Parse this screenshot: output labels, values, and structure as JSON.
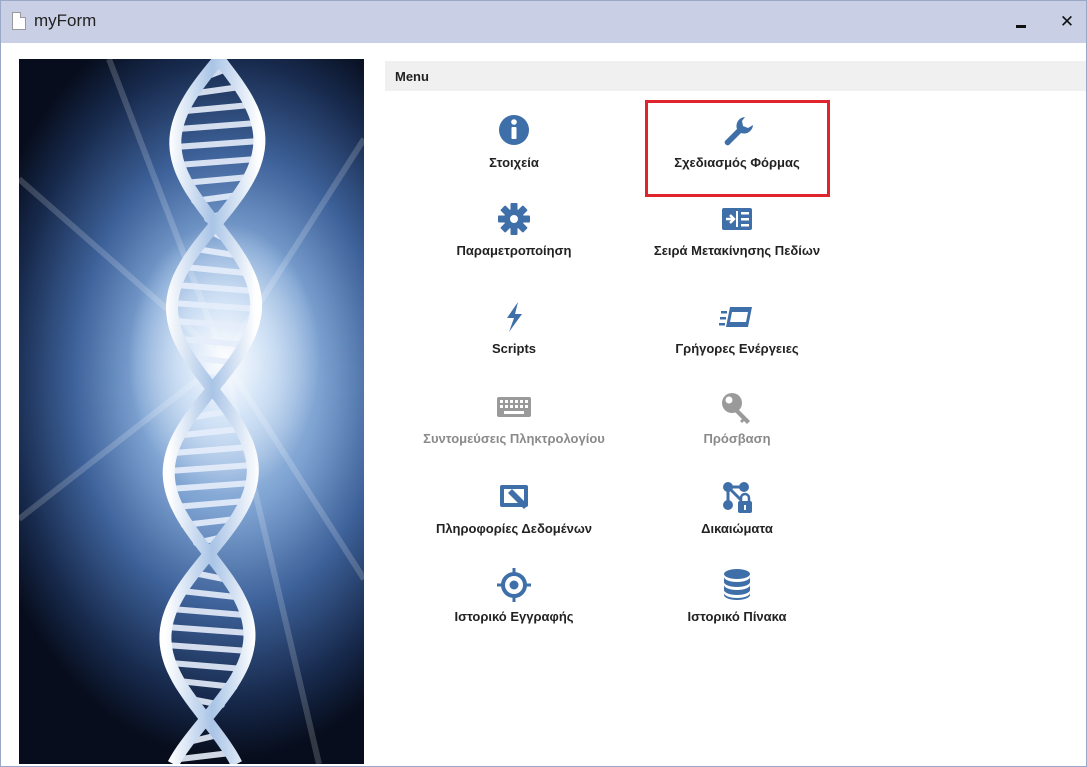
{
  "window": {
    "title": "myForm",
    "minimize_label": "‒",
    "close_label": "✕"
  },
  "menu": {
    "header": "Menu",
    "items": [
      {
        "label": "Στοιχεία",
        "icon": "info-icon",
        "enabled": true
      },
      {
        "label": "Σχεδιασμός Φόρμας",
        "icon": "wrench-icon",
        "enabled": true,
        "highlighted": true
      },
      {
        "label": "Παραμετροποίηση",
        "icon": "gear-icon",
        "enabled": true
      },
      {
        "label": "Σειρά Μετακίνησης Πεδίων",
        "icon": "tab-order-icon",
        "enabled": true
      },
      {
        "label": "Scripts",
        "icon": "lightning-icon",
        "enabled": true
      },
      {
        "label": "Γρήγορες Ενέργειες",
        "icon": "quick-actions-icon",
        "enabled": true
      },
      {
        "label": "Συντομεύσεις Πληκτρολογίου",
        "icon": "keyboard-icon",
        "enabled": false
      },
      {
        "label": "Πρόσβαση",
        "icon": "key-icon",
        "enabled": false
      },
      {
        "label": "Πληροφορίες Δεδομένων",
        "icon": "data-info-icon",
        "enabled": true
      },
      {
        "label": "Δικαιώματα",
        "icon": "permissions-icon",
        "enabled": true
      },
      {
        "label": "Ιστορικό Εγγραφής",
        "icon": "record-history-icon",
        "enabled": true
      },
      {
        "label": "Ιστορικό Πίνακα",
        "icon": "database-icon",
        "enabled": true
      }
    ]
  },
  "colors": {
    "icon_blue": "#3f6fa8",
    "icon_disabled": "#9a9a9a",
    "highlight": "#e0242c",
    "titlebar": "#c9cfe4"
  }
}
